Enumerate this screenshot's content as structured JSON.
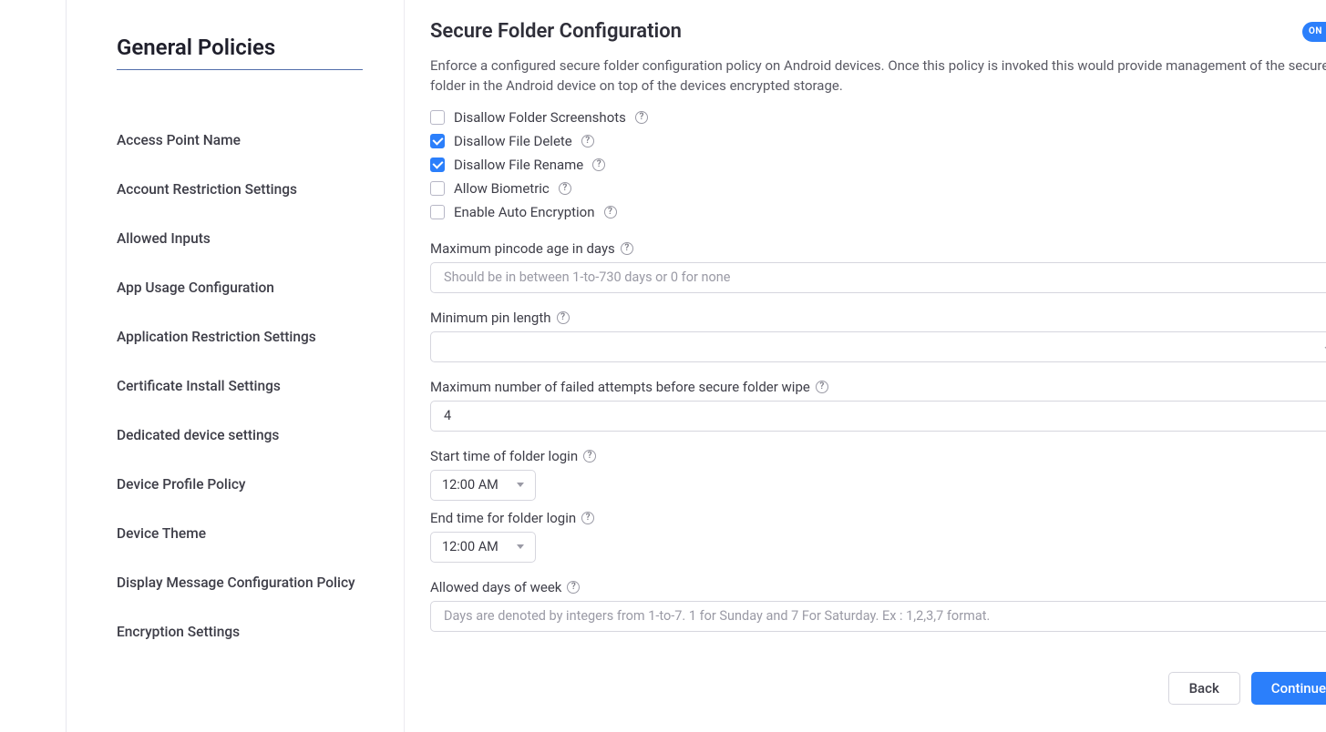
{
  "sidebar": {
    "heading": "General Policies",
    "items": [
      "Access Point Name",
      "Account Restriction Settings",
      "Allowed Inputs",
      "App Usage Configuration",
      "Application Restriction Settings",
      "Certificate Install Settings",
      "Dedicated device settings",
      "Device Profile Policy",
      "Device Theme",
      "Display Message Configuration Policy",
      "Encryption Settings"
    ]
  },
  "main": {
    "title": "Secure Folder Configuration",
    "toggle_label": "ON",
    "description": "Enforce a configured secure folder configuration policy on Android devices. Once this policy is invoked this would provide management of the secure folder in the Android device on top of the devices encrypted storage.",
    "checkboxes": [
      {
        "label": "Disallow Folder Screenshots",
        "checked": false
      },
      {
        "label": "Disallow File Delete",
        "checked": true
      },
      {
        "label": "Disallow File Rename",
        "checked": true
      },
      {
        "label": "Allow Biometric",
        "checked": false
      },
      {
        "label": "Enable Auto Encryption",
        "checked": false
      }
    ],
    "fields": {
      "max_pincode_age": {
        "label": "Maximum pincode age in days",
        "placeholder": "Should be in between 1-to-730 days or 0 for none",
        "value": ""
      },
      "min_pin_length": {
        "label": "Minimum pin length",
        "value": ""
      },
      "max_failed": {
        "label": "Maximum number of failed attempts before secure folder wipe",
        "value": "4"
      },
      "start_time": {
        "label": "Start time of folder login",
        "value": "12:00 AM"
      },
      "end_time": {
        "label": "End time for folder login",
        "value": "12:00 AM"
      },
      "allowed_days": {
        "label": "Allowed days of week",
        "placeholder": "Days are denoted by integers from 1-to-7. 1 for Sunday and 7 For Saturday. Ex : 1,2,3,7 format.",
        "value": ""
      }
    },
    "buttons": {
      "back": "Back",
      "continue": "Continue"
    }
  }
}
